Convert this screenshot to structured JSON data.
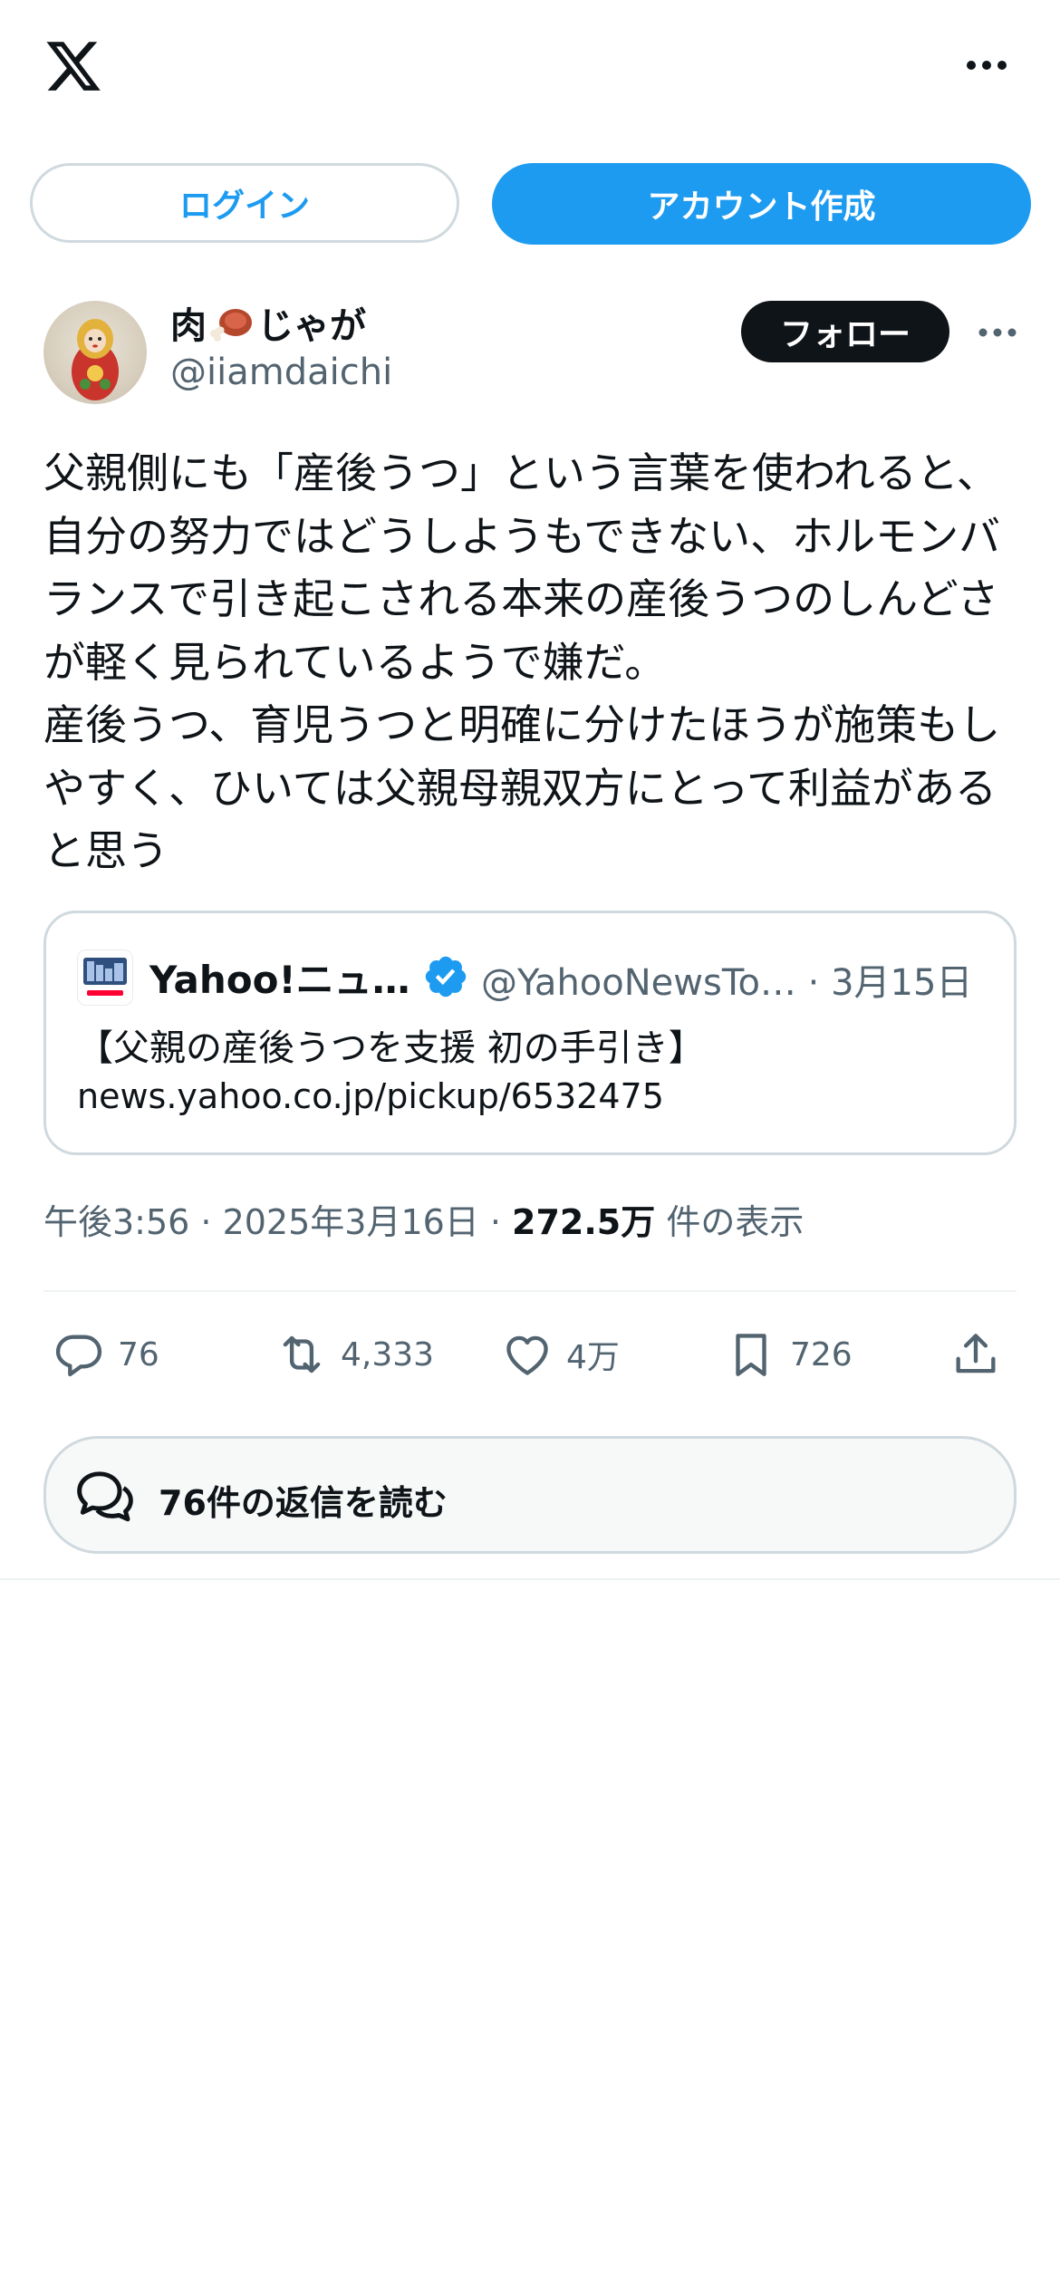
{
  "header": {
    "logo": "x-logo-icon",
    "more": "more-horizontal-icon"
  },
  "auth": {
    "login_label": "ログイン",
    "signup_label": "アカウント作成"
  },
  "author": {
    "name_prefix": "肉",
    "name_suffix": "じゃが",
    "name_emoji_icon": "meat-on-bone-icon",
    "handle": "@iiamdaichi",
    "follow_label": "フォロー"
  },
  "tweet": {
    "text": "父親側にも「産後うつ」という言葉を使われると、自分の努力ではどうしようもできない、ホルモンバランスで引き起こされる本来の産後うつのしんどさが軽く見られているようで嫌だ。\n産後うつ、育児うつと明確に分けたほうが施策もしやすく、ひいては父親母親双方にとって利益があると思う"
  },
  "quote": {
    "name": "Yahoo!ニュ…",
    "handle_date": "@YahooNewsTo… · 3月15日",
    "text": "【父親の産後うつを支援 初の手引き】",
    "link": "news.yahoo.co.jp/pickup/6532475"
  },
  "meta": {
    "time_date": "午後3:56 · 2025年3月16日 · ",
    "views_count": "272.5万",
    "views_label": " 件の表示"
  },
  "actions": {
    "replies": "76",
    "retweets": "4,333",
    "likes": "4万",
    "bookmarks": "726"
  },
  "read_replies": {
    "label": "76件の返信を読む"
  },
  "colors": {
    "accent": "#1d9bf0",
    "text": "#0f1419",
    "secondary": "#536471",
    "border": "#cfd9de"
  }
}
